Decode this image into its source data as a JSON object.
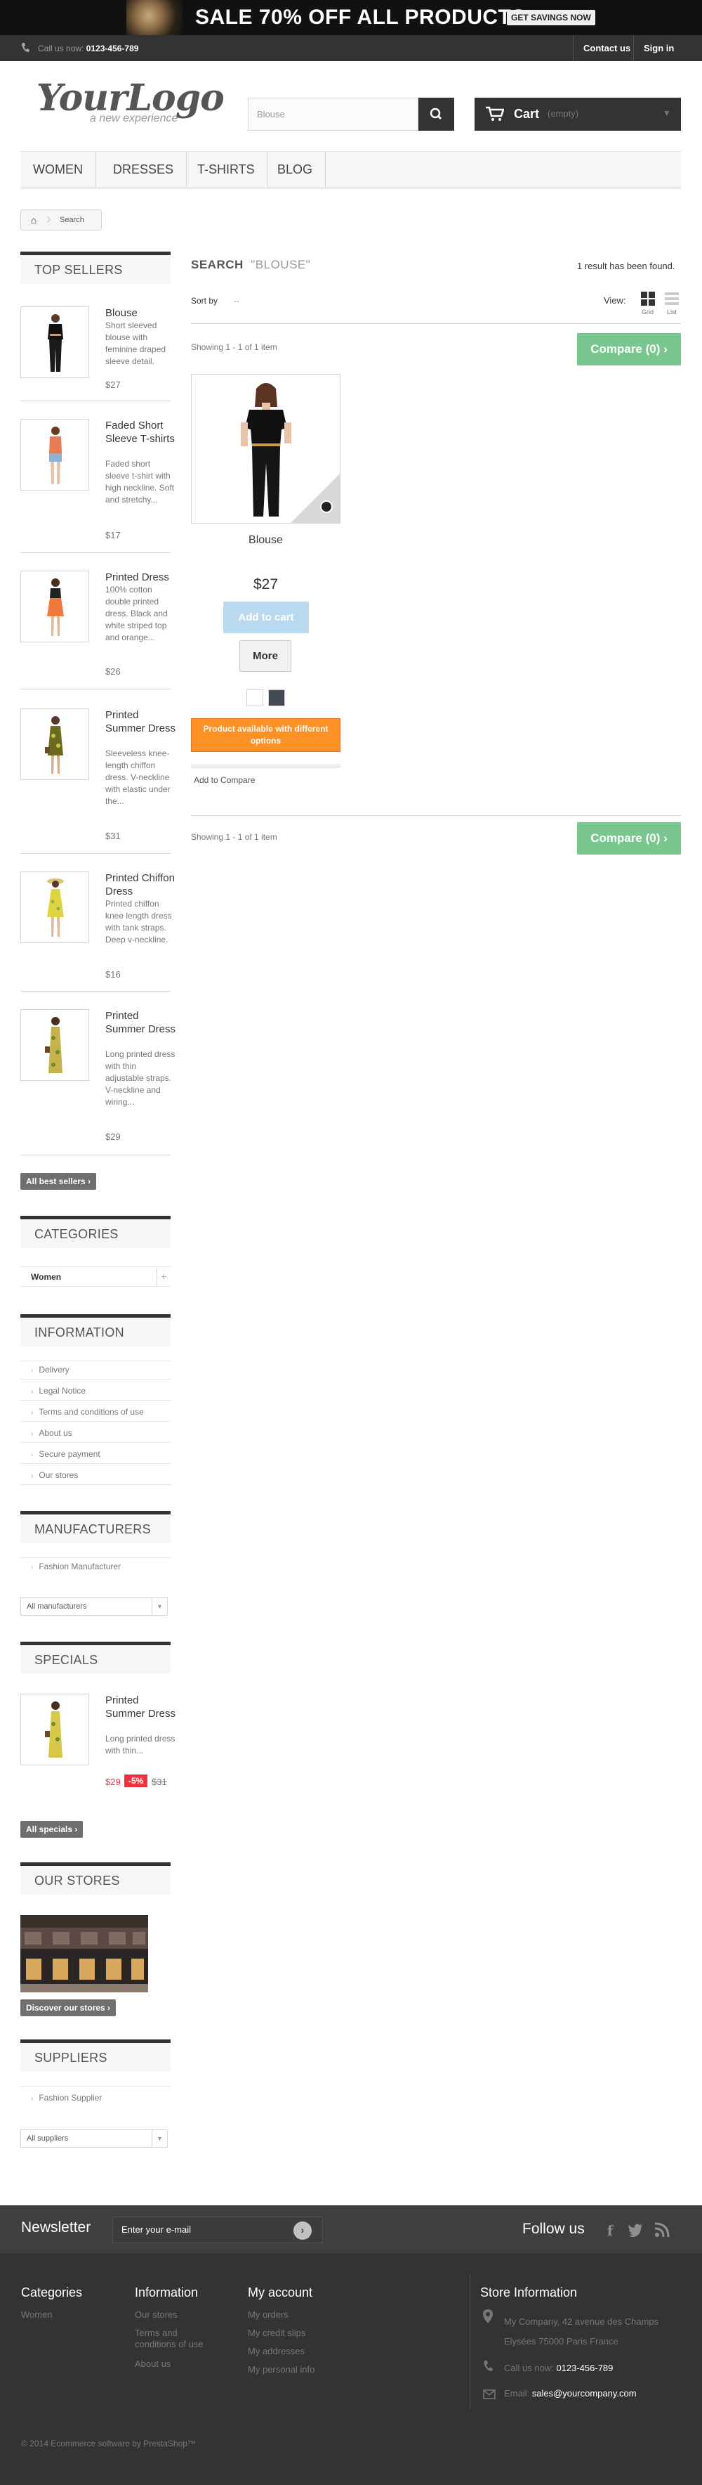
{
  "banner": {
    "text": "SALE 70% OFF ALL PRODUCTS",
    "button": "GET SAVINGS NOW"
  },
  "topnav": {
    "call_label": "Call us now:",
    "phone": "0123-456-789",
    "contact": "Contact us",
    "signin": "Sign in"
  },
  "logo": {
    "main": "YourLogo",
    "tagline": "a new experience"
  },
  "search": {
    "value": "Blouse"
  },
  "cart": {
    "label": "Cart",
    "status": "(empty)"
  },
  "menu": {
    "items": [
      "WOMEN",
      "DRESSES",
      "T-SHIRTS",
      "BLOG"
    ]
  },
  "breadcrumb": {
    "current": "Search"
  },
  "top_sellers": {
    "title": "TOP SELLERS",
    "items": [
      {
        "name": "Blouse",
        "desc": "Short sleeved blouse with feminine draped sleeve detail.",
        "price": "$27"
      },
      {
        "name": "Faded Short Sleeve T-shirts",
        "desc": "Faded short sleeve t-shirt with high neckline. Soft and stretchy...",
        "price": "$17"
      },
      {
        "name": "Printed Dress",
        "desc": "100% cotton double printed dress. Black and white striped top and orange...",
        "price": "$26"
      },
      {
        "name": "Printed Summer Dress",
        "desc": "Sleeveless knee-length chiffon dress. V-neckline with elastic under the...",
        "price": "$31"
      },
      {
        "name": "Printed Chiffon Dress",
        "desc": "Printed chiffon knee length dress with tank straps. Deep v-neckline.",
        "price": "$16"
      },
      {
        "name": "Printed Summer Dress",
        "desc": "Long printed dress with thin adjustable straps. V-neckline and wiring...",
        "price": "$29"
      }
    ],
    "all_button": "All best sellers"
  },
  "categories": {
    "title": "CATEGORIES",
    "items": [
      "Women"
    ]
  },
  "information": {
    "title": "INFORMATION",
    "items": [
      "Delivery",
      "Legal Notice",
      "Terms and conditions of use",
      "About us",
      "Secure payment",
      "Our stores"
    ]
  },
  "manufacturers": {
    "title": "MANUFACTURERS",
    "items": [
      "Fashion Manufacturer"
    ],
    "select": "All manufacturers"
  },
  "specials": {
    "title": "SPECIALS",
    "name": "Printed Summer Dress",
    "desc": "Long printed dress with thin...",
    "price": "$29",
    "discount": "-5%",
    "old_price": "$31",
    "all_button": "All specials"
  },
  "our_stores": {
    "title": "OUR STORES",
    "button": "Discover our stores"
  },
  "suppliers": {
    "title": "SUPPLIERS",
    "items": [
      "Fashion Supplier"
    ],
    "select": "All suppliers"
  },
  "results": {
    "heading": "SEARCH",
    "query": "\"BLOUSE\"",
    "count": "1 result has been found.",
    "sort_label": "Sort by",
    "sort_value": "--",
    "view_label": "View:",
    "grid": "Grid",
    "list": "List",
    "showing": "Showing 1 - 1 of 1 item",
    "compare": "Compare (0)"
  },
  "product": {
    "name": "Blouse",
    "price": "$27",
    "add_to_cart": "Add to cart",
    "more": "More",
    "colors": [
      "#ffffff",
      "#434a54"
    ],
    "availability": "Product available with different options",
    "add_compare": "Add to Compare"
  },
  "newsletter": {
    "title": "Newsletter",
    "placeholder": "Enter your e-mail",
    "follow": "Follow us"
  },
  "footer": {
    "categories": {
      "title": "Categories",
      "items": [
        "Women"
      ]
    },
    "information": {
      "title": "Information",
      "items": [
        "Our stores",
        "Terms and conditions of use",
        "About us"
      ]
    },
    "account": {
      "title": "My account",
      "items": [
        "My orders",
        "My credit slips",
        "My addresses",
        "My personal info"
      ]
    },
    "store": {
      "title": "Store Information",
      "address": "My Company, 42 avenue des Champs Elysées 75000 Paris France",
      "call_label": "Call us now:",
      "phone": "0123-456-789",
      "email_label": "Email:",
      "email": "sales@yourcompany.com"
    },
    "copyright": "© 2014 Ecommerce software by PrestaShop™"
  },
  "colors": {
    "dark": "#333333",
    "compare_green": "#79c78f",
    "orange": "#fe9126",
    "sale_red": "#f13340",
    "add_cart_blue": "#b8d9ef"
  }
}
